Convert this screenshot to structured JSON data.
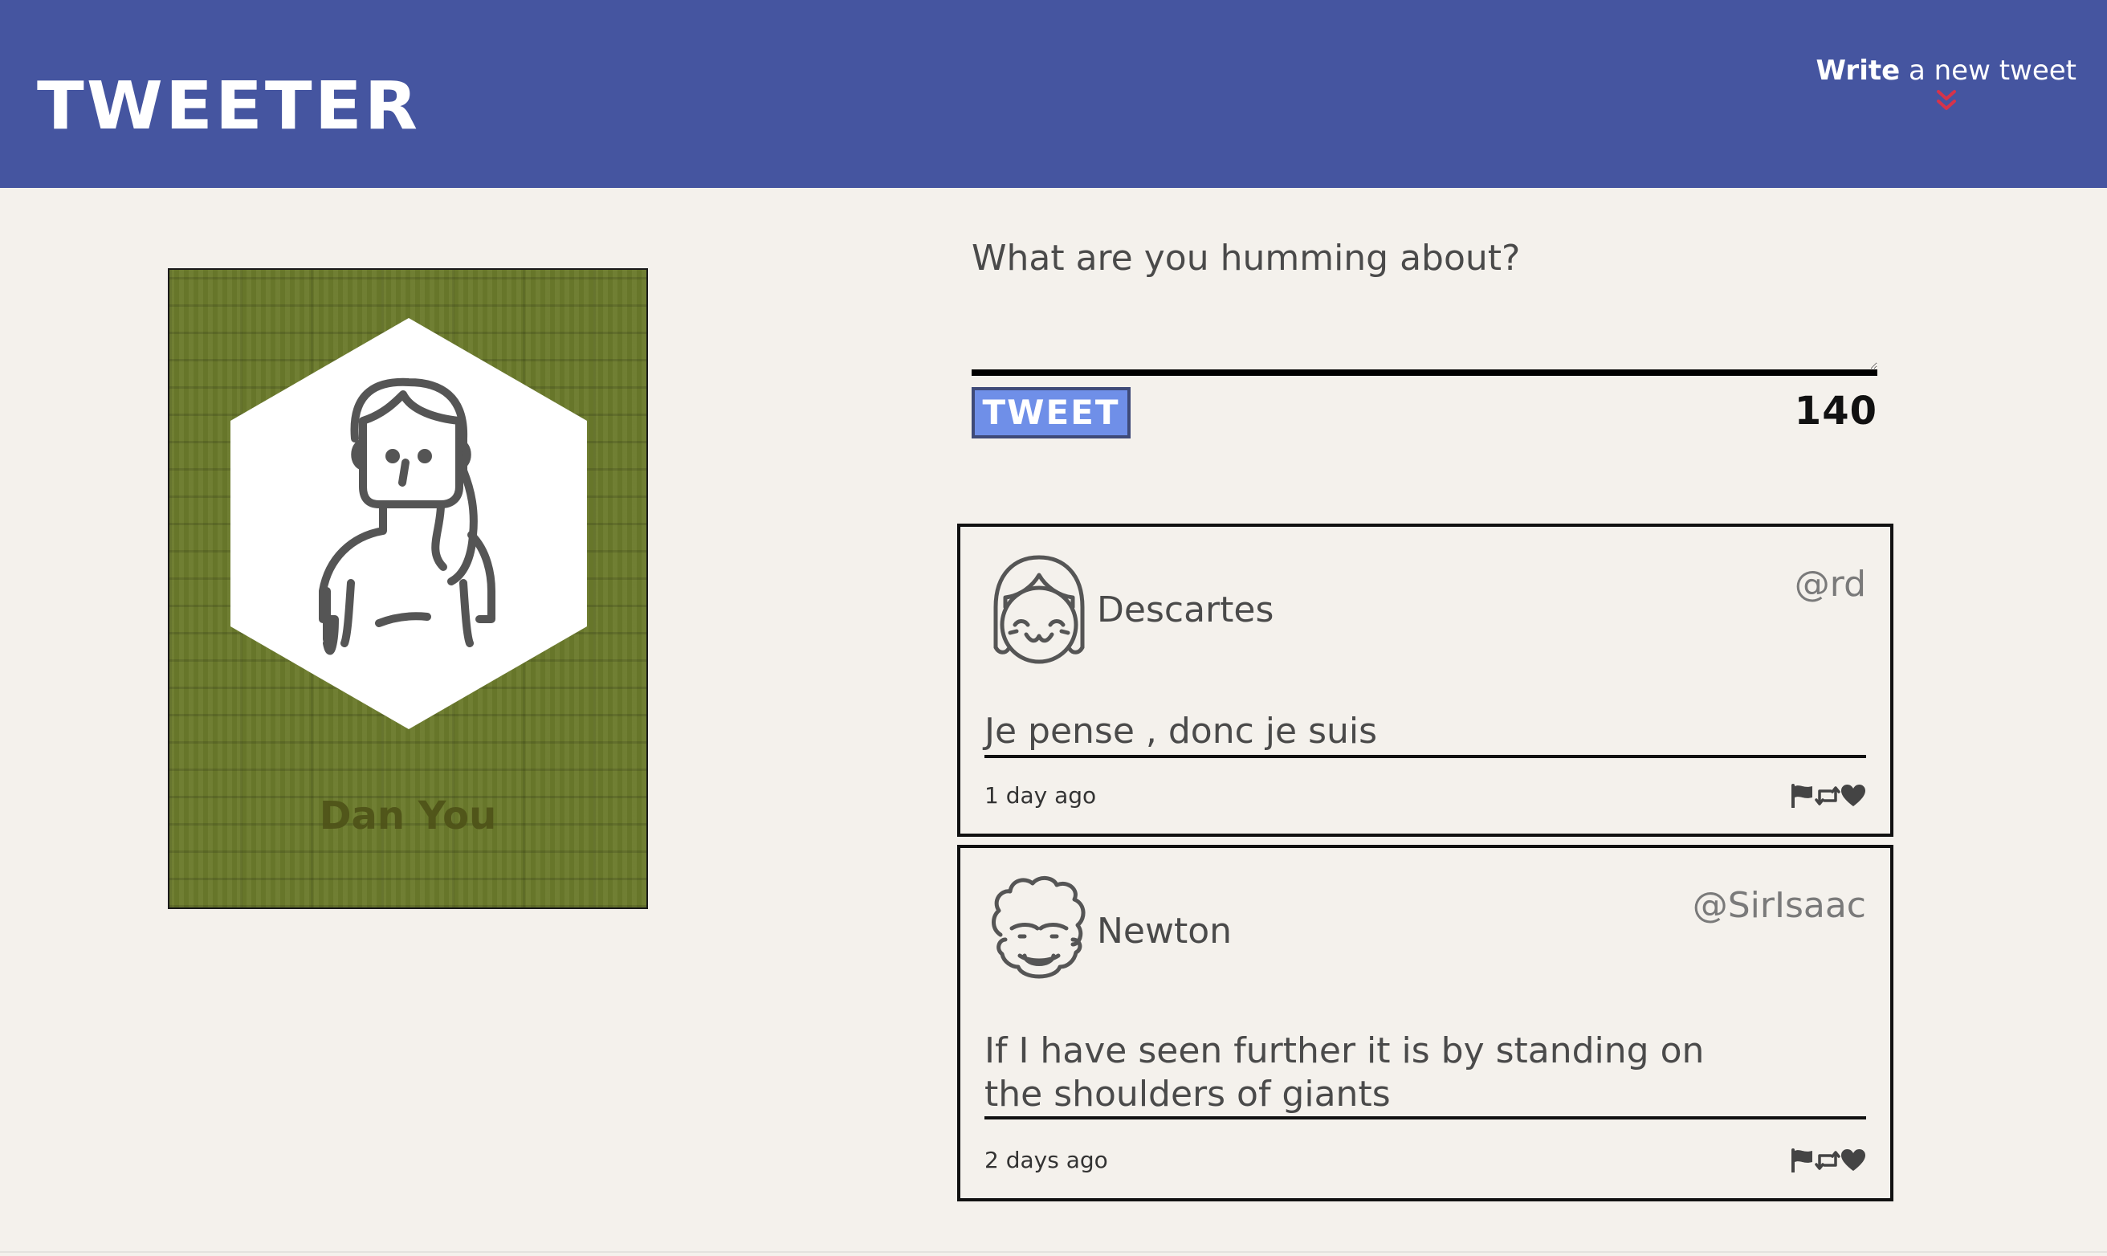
{
  "nav": {
    "logo": "TWEETER",
    "compose_bold": "Write",
    "compose_rest": "a new tweet",
    "chevron_color": "#d6334a"
  },
  "profile": {
    "name": "Dan You"
  },
  "composer": {
    "placeholder": "What are you humming about?",
    "button_label": "TWEET",
    "char_count": "140"
  },
  "tweets": [
    {
      "display_name": "Descartes",
      "handle": "@rd",
      "body": "Je pense , donc je suis",
      "timestamp": "1 day ago",
      "avatar_icon": "girl-avatar-icon"
    },
    {
      "display_name": "Newton",
      "handle": "@SirIsaac",
      "body": "If I have seen further it is by standing on the shoulders of giants",
      "timestamp": "2 days ago",
      "avatar_icon": "curly-hair-avatar-icon"
    }
  ],
  "colors": {
    "nav_bg": "#4555a0",
    "page_bg": "#f4f1ec",
    "button_bg": "#6f8fe8",
    "profile_bg": "#6b7a2c"
  }
}
